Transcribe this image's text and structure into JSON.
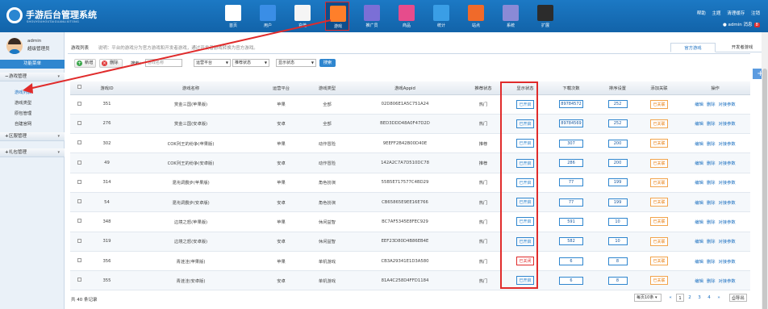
{
  "app": {
    "title": "手游后台管理系统",
    "subtitle": "SHOUYOUHOUTAIGUANLIXITONG"
  },
  "nav": [
    {
      "label": "首页",
      "color": "#ffffff"
    },
    {
      "label": "用户",
      "color": "#3a8ee6"
    },
    {
      "label": "充值",
      "color": "#f5f5f5"
    },
    {
      "label": "游戏",
      "color": "#ff7f2a",
      "active": true
    },
    {
      "label": "推广员",
      "color": "#7b6fd6"
    },
    {
      "label": "商品",
      "color": "#e64c8c"
    },
    {
      "label": "统计",
      "color": "#3a9ee6"
    },
    {
      "label": "站点",
      "color": "#f06a2a"
    },
    {
      "label": "系统",
      "color": "#8a8ad6"
    },
    {
      "label": "扩展",
      "color": "#2c2c2c"
    }
  ],
  "top_links": [
    "帮助",
    "主题",
    "清理缓存",
    "注销"
  ],
  "user_line": {
    "name": "admin",
    "msg_label": "消息",
    "msg_count": "8"
  },
  "sidebar": {
    "user": {
      "name": "admin",
      "role": "超级管理员"
    },
    "menu_title": "功能菜单",
    "groups": [
      {
        "label": "游戏管理",
        "expanded": true,
        "items": [
          "游戏列表",
          "游戏类型",
          "原包管理",
          "自建官网"
        ]
      },
      {
        "label": "区服管理",
        "expanded": false
      },
      {
        "label": "礼包管理",
        "expanded": false
      }
    ]
  },
  "page": {
    "title": "游戏列表",
    "description": "说明：平台的游戏分为官方游戏和开发者游戏，通过开发者游戏转换为官方游戏。",
    "tabs": [
      "官方游戏",
      "开发者游戏"
    ]
  },
  "toolbar": {
    "add": "新增",
    "delete": "删除",
    "search_label": "搜索：",
    "game_name_placeholder": "游戏名称",
    "platform": "运营平台",
    "recommend": "推荐状态",
    "display": "显示状态",
    "search_btn": "搜索"
  },
  "table": {
    "headers": [
      "游戏ID",
      "游戏名称",
      "运营平台",
      "游戏类型",
      "游戏Appid",
      "推荐状态",
      "显示状态",
      "下载次数",
      "排序设置",
      "添加关联",
      "操作"
    ],
    "rows": [
      {
        "id": "351",
        "name": "赏金三国(苹果版)",
        "platform": "苹果",
        "type": "全部",
        "appid": "02D806E1A5C751A24",
        "recommend": "热门",
        "display": "已开启",
        "downloads": "89784572",
        "sort": "252",
        "relation": "已关联"
      },
      {
        "id": "276",
        "name": "赏金三国(安卓版)",
        "platform": "安卓",
        "type": "全部",
        "appid": "BED3DDD48A0F47D2D",
        "recommend": "热门",
        "display": "已开启",
        "downloads": "89784569",
        "sort": "252",
        "relation": "已关联"
      },
      {
        "id": "302",
        "name": "COK列王的纷争(苹果版)",
        "platform": "苹果",
        "type": "动作冒险",
        "appid": "9EEFF2B42B00D40E",
        "recommend": "推荐",
        "display": "已开启",
        "downloads": "307",
        "sort": "200",
        "relation": "已关联"
      },
      {
        "id": "49",
        "name": "COK列王的纷争(安卓版)",
        "platform": "安卓",
        "type": "动作冒险",
        "appid": "142A2C7A7D510DC78",
        "recommend": "推荐",
        "display": "已开启",
        "downloads": "286",
        "sort": "200",
        "relation": "已关联"
      },
      {
        "id": "314",
        "name": "混沌调霸步(苹果版)",
        "platform": "苹果",
        "type": "角色扮演",
        "appid": "55B5E717577C4BD29",
        "recommend": "热门",
        "display": "已开启",
        "downloads": "77",
        "sort": "199",
        "relation": "已关联"
      },
      {
        "id": "54",
        "name": "混沌调霸步(安卓版)",
        "platform": "安卓",
        "type": "角色扮演",
        "appid": "CB65865E9EE16E766",
        "recommend": "热门",
        "display": "已开启",
        "downloads": "77",
        "sort": "199",
        "relation": "已关联"
      },
      {
        "id": "348",
        "name": "边境之怒(苹果版)",
        "platform": "苹果",
        "type": "休闲益智",
        "appid": "BC7AF5345E8FEC929",
        "recommend": "热门",
        "display": "已开启",
        "downloads": "591",
        "sort": "10",
        "relation": "已关联"
      },
      {
        "id": "319",
        "name": "边境之怒(安卓版)",
        "platform": "安卓",
        "type": "休闲益智",
        "appid": "EEF23D80D4B86EB4E",
        "recommend": "热门",
        "display": "已开启",
        "downloads": "582",
        "sort": "10",
        "relation": "已关联"
      },
      {
        "id": "356",
        "name": "青涟洼(苹果版)",
        "platform": "苹果",
        "type": "单机游戏",
        "appid": "CB3A29341E1D3A580",
        "recommend": "热门",
        "display": "已关闭",
        "downloads": "6",
        "sort": "8",
        "relation": "已关联"
      },
      {
        "id": "355",
        "name": "青涟洼(安卓版)",
        "platform": "安卓",
        "type": "单机游戏",
        "appid": "81A4C258D4FFD1184",
        "recommend": "热门",
        "display": "已开启",
        "downloads": "6",
        "sort": "8",
        "relation": "已关联"
      }
    ],
    "ops": [
      "编辑",
      "删除",
      "对接参数"
    ]
  },
  "footer": {
    "total": "共 40 条记录",
    "per_page": "每页10条",
    "pages": [
      "«",
      "1",
      "2",
      "3",
      "4",
      "»"
    ],
    "current_page": "1",
    "export": "导出"
  }
}
